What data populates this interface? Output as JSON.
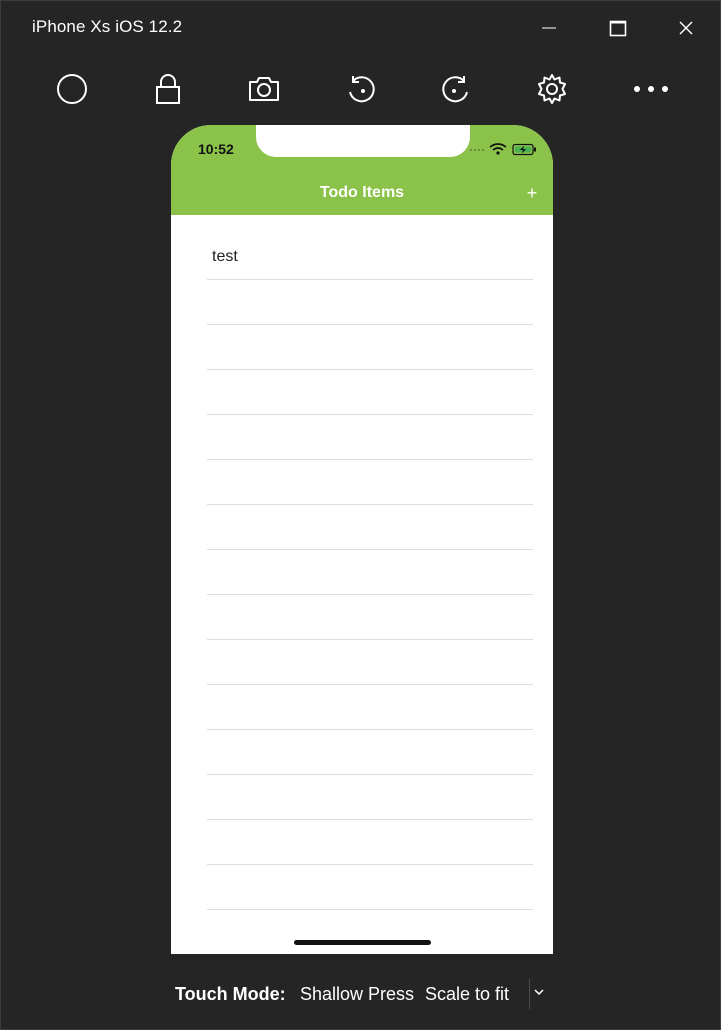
{
  "window": {
    "title": "iPhone Xs iOS 12.2",
    "controls": {
      "minimize_icon": "minimize-icon",
      "maximize_icon": "maximize-icon",
      "close_icon": "close-icon"
    }
  },
  "toolbar": {
    "items": [
      {
        "icon": "home-circle-icon"
      },
      {
        "icon": "lock-icon"
      },
      {
        "icon": "camera-icon"
      },
      {
        "icon": "rotate-left-icon"
      },
      {
        "icon": "rotate-right-icon"
      },
      {
        "icon": "gear-icon"
      },
      {
        "icon": "more-icon"
      }
    ]
  },
  "phone": {
    "status": {
      "time": "10:52"
    },
    "navbar": {
      "title": "Todo Items",
      "add_label": "+",
      "color": "#8bc34a"
    },
    "list": {
      "items": [
        "test",
        "",
        "",
        "",
        "",
        "",
        "",
        "",
        "",
        "",
        "",
        "",
        "",
        "",
        "",
        ""
      ]
    }
  },
  "bottombar": {
    "touch_mode_label": "Touch Mode:",
    "touch_mode_value": "Shallow Press",
    "scale_value": "Scale to fit"
  }
}
